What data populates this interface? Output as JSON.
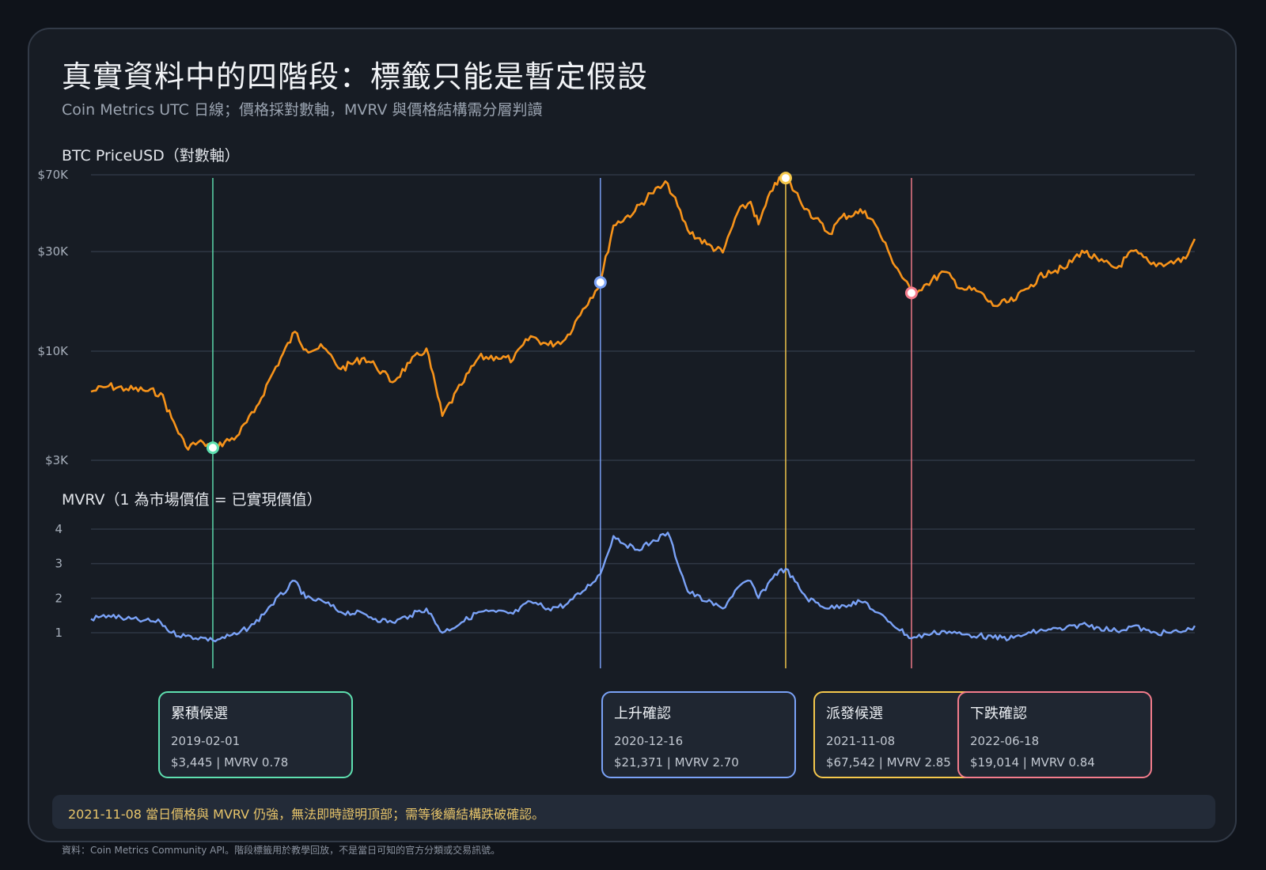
{
  "title": "真實資料中的四階段：標籤只能是暫定假設",
  "subtitle": "Coin Metrics UTC 日線；價格採對數軸，MVRV 與價格結構需分層判讀",
  "price_panel_label": "BTC PriceUSD（對數軸）",
  "mvrv_panel_label": "MVRV（1 為市場價值 = 已實現價值）",
  "note": "2021-11-08 當日價格與 MVRV 仍強，無法即時證明頂部；需等後續結構跌破確認。",
  "source": "資料：Coin Metrics Community API。階段標籤用於教學回放，不是當日可知的官方分類或交易訊號。",
  "colors": {
    "price_line": "#f7931a",
    "mvrv_line": "#7aa2f7",
    "accumulation": "#5ee0b0",
    "markup": "#7aa2f7",
    "distribution": "#f5c84c",
    "markdown": "#f47c8c"
  },
  "phases": [
    {
      "key": "accumulation",
      "label": "累積候選",
      "date": "2019-02-01",
      "value_text": "$3,445 | MVRV 0.78"
    },
    {
      "key": "markup",
      "label": "上升確認",
      "date": "2020-12-16",
      "value_text": "$21,371 | MVRV 2.70"
    },
    {
      "key": "distribution",
      "label": "派發候選",
      "date": "2021-11-08",
      "value_text": "$67,542 | MVRV 2.85"
    },
    {
      "key": "markdown",
      "label": "下跌確認",
      "date": "2022-06-18",
      "value_text": "$19,014 | MVRV 0.84"
    }
  ],
  "chart_data": [
    {
      "type": "line",
      "ylabel": "BTC PriceUSD（對數軸）",
      "yscale": "log",
      "ylim": [
        3000,
        70000
      ],
      "yticks": [
        3000,
        10000,
        30000,
        70000
      ],
      "ytick_labels": [
        "$3K",
        "$10K",
        "$30K",
        "$70K"
      ],
      "xlim": [
        "2018-07-01",
        "2023-10-31"
      ],
      "grid": true,
      "series": [
        {
          "x": [
            "2018-07-01",
            "2018-08-01",
            "2018-09-01",
            "2018-10-01",
            "2018-11-01",
            "2018-11-20",
            "2018-12-15",
            "2019-01-15",
            "2019-02-01",
            "2019-03-15",
            "2019-04-15",
            "2019-05-15",
            "2019-06-26",
            "2019-07-15",
            "2019-08-15",
            "2019-09-15",
            "2019-10-26",
            "2019-11-15",
            "2019-12-15",
            "2020-01-15",
            "2020-02-13",
            "2020-03-12",
            "2020-04-15",
            "2020-05-15",
            "2020-06-15",
            "2020-07-15",
            "2020-08-15",
            "2020-09-15",
            "2020-10-15",
            "2020-11-15",
            "2020-12-16",
            "2021-01-08",
            "2021-02-15",
            "2021-03-15",
            "2021-04-14",
            "2021-05-19",
            "2021-06-22",
            "2021-07-20",
            "2021-08-15",
            "2021-09-07",
            "2021-09-21",
            "2021-10-20",
            "2021-11-08",
            "2021-12-15",
            "2022-01-24",
            "2022-02-15",
            "2022-03-28",
            "2022-04-15",
            "2022-05-12",
            "2022-06-18",
            "2022-07-15",
            "2022-08-15",
            "2022-09-15",
            "2022-10-15",
            "2022-11-09",
            "2022-12-15",
            "2023-01-15",
            "2023-02-15",
            "2023-03-15",
            "2023-04-15",
            "2023-05-15",
            "2023-06-15",
            "2023-07-15",
            "2023-08-15",
            "2023-09-15",
            "2023-10-15",
            "2023-10-31"
          ],
          "y": [
            6400,
            6800,
            6600,
            6500,
            6300,
            4800,
            3500,
            3650,
            3445,
            3900,
            5100,
            7600,
            12400,
            10200,
            10400,
            8200,
            9300,
            8500,
            7100,
            8800,
            10300,
            4900,
            6900,
            9300,
            9400,
            9100,
            11800,
            10700,
            11400,
            15900,
            21371,
            40000,
            47000,
            57000,
            63500,
            38000,
            32500,
            29700,
            46000,
            52000,
            40500,
            64000,
            67542,
            48000,
            36500,
            44000,
            47000,
            40500,
            28500,
            19014,
            21000,
            24000,
            20000,
            19300,
            16500,
            17400,
            20800,
            24300,
            24800,
            30300,
            27000,
            25000,
            30200,
            26100,
            26500,
            27800,
            34500
          ]
        }
      ]
    },
    {
      "type": "line",
      "ylabel": "MVRV（1 為市場價值 = 已實現價值）",
      "ylim": [
        0.5,
        4.1
      ],
      "yticks": [
        1,
        2,
        3,
        4
      ],
      "ytick_labels": [
        "1",
        "2",
        "3",
        "4"
      ],
      "xlim": [
        "2018-07-01",
        "2023-10-31"
      ],
      "grid": true,
      "series": [
        {
          "x": [
            "2018-07-01",
            "2018-08-01",
            "2018-09-01",
            "2018-10-01",
            "2018-11-01",
            "2018-11-20",
            "2018-12-15",
            "2019-01-15",
            "2019-02-01",
            "2019-03-15",
            "2019-04-15",
            "2019-05-15",
            "2019-06-26",
            "2019-07-15",
            "2019-08-15",
            "2019-09-15",
            "2019-10-26",
            "2019-11-15",
            "2019-12-15",
            "2020-01-15",
            "2020-02-13",
            "2020-03-12",
            "2020-04-15",
            "2020-05-15",
            "2020-06-15",
            "2020-07-15",
            "2020-08-15",
            "2020-09-15",
            "2020-10-15",
            "2020-11-15",
            "2020-12-16",
            "2021-01-08",
            "2021-02-15",
            "2021-03-15",
            "2021-04-14",
            "2021-05-19",
            "2021-06-22",
            "2021-07-20",
            "2021-08-15",
            "2021-09-07",
            "2021-09-21",
            "2021-10-20",
            "2021-11-08",
            "2021-12-15",
            "2022-01-24",
            "2022-02-15",
            "2022-03-28",
            "2022-04-15",
            "2022-05-12",
            "2022-06-18",
            "2022-07-15",
            "2022-08-15",
            "2022-09-15",
            "2022-10-15",
            "2022-11-09",
            "2022-12-15",
            "2023-01-15",
            "2023-02-15",
            "2023-03-15",
            "2023-04-15",
            "2023-05-15",
            "2023-06-15",
            "2023-07-15",
            "2023-08-15",
            "2023-09-15",
            "2023-10-15",
            "2023-10-31"
          ],
          "y": [
            1.4,
            1.5,
            1.4,
            1.35,
            1.3,
            1.0,
            0.9,
            0.85,
            0.78,
            0.95,
            1.25,
            1.8,
            2.5,
            2.0,
            1.9,
            1.6,
            1.55,
            1.4,
            1.3,
            1.5,
            1.7,
            1.0,
            1.3,
            1.6,
            1.6,
            1.55,
            1.9,
            1.7,
            1.8,
            2.2,
            2.7,
            3.8,
            3.4,
            3.6,
            3.9,
            2.2,
            1.9,
            1.7,
            2.3,
            2.5,
            2.0,
            2.7,
            2.85,
            2.0,
            1.7,
            1.8,
            1.9,
            1.6,
            1.3,
            0.84,
            0.95,
            1.05,
            0.95,
            0.92,
            0.85,
            0.85,
            1.0,
            1.1,
            1.1,
            1.25,
            1.15,
            1.05,
            1.2,
            1.0,
            1.0,
            1.05,
            1.2
          ]
        }
      ]
    }
  ]
}
